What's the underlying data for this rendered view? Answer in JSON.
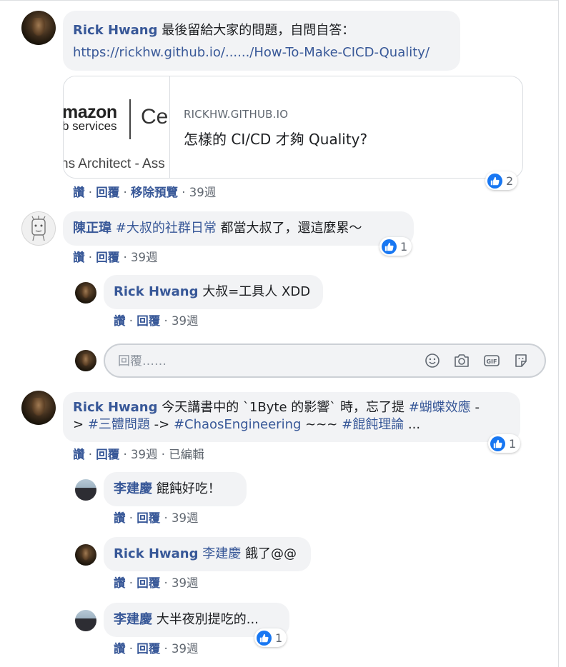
{
  "comments": [
    {
      "author": "Rick Hwang",
      "text": "最後留給大家的問題，自問自答：",
      "link": "https://rickhw.github.io/....../How-To-Make-CICD-Quality/",
      "preview": {
        "image_text": [
          "mazon",
          "b services",
          "Ce",
          "ns Architect - Ass"
        ],
        "domain": "RICKHW.GITHUB.IO",
        "title": "怎樣的 CI/CD 才夠 Quality?"
      },
      "reactions": "2",
      "actions": {
        "like": "讚",
        "reply": "回覆",
        "remove_preview": "移除預覽",
        "time": "39週"
      }
    },
    {
      "author": "陳正瑋",
      "tag": "#大叔的社群日常",
      "text": " 都當大叔了，還這麼累～",
      "reactions": "1",
      "actions": {
        "like": "讚",
        "reply": "回覆",
        "time": "39週"
      },
      "replies": [
        {
          "author": "Rick Hwang",
          "text": " 大叔=工具人 XDD",
          "actions": {
            "like": "讚",
            "reply": "回覆",
            "time": "39週"
          }
        }
      ]
    },
    {
      "author": "Rick Hwang",
      "text1": " 今天講書中的 `1Byte 的影響` 時，忘了提 ",
      "tag1": "#蝴蝶效應",
      "text2": " -",
      "text3": "> ",
      "tag2": "#三體問題",
      "text4": " -> ",
      "tag3": "#ChaosEngineering",
      "text5": " ~~~ ",
      "tag4": "#餛飩理論",
      "text6": " ...",
      "reactions": "1",
      "actions": {
        "like": "讚",
        "reply": "回覆",
        "time": "39週",
        "edited": "已編輯"
      },
      "replies": [
        {
          "author": "李建慶",
          "text": " 餛飩好吃！",
          "actions": {
            "like": "讚",
            "reply": "回覆",
            "time": "39週"
          }
        },
        {
          "author": "Rick Hwang",
          "mention": "李建慶",
          "text": " 餓了@@",
          "actions": {
            "like": "讚",
            "reply": "回覆",
            "time": "39週"
          }
        },
        {
          "author": "李建慶",
          "text": " 大半夜別提吃的...",
          "reactions": "1",
          "actions": {
            "like": "讚",
            "reply": "回覆",
            "time": "39週"
          }
        }
      ]
    }
  ],
  "reply_box": {
    "placeholder": "回覆……"
  },
  "icons": [
    "like-icon",
    "emoji-icon",
    "camera-icon",
    "gif-icon",
    "sticker-icon"
  ],
  "colors": {
    "link": "#385898",
    "bubble": "#f2f3f5",
    "like": "#1877f2"
  }
}
